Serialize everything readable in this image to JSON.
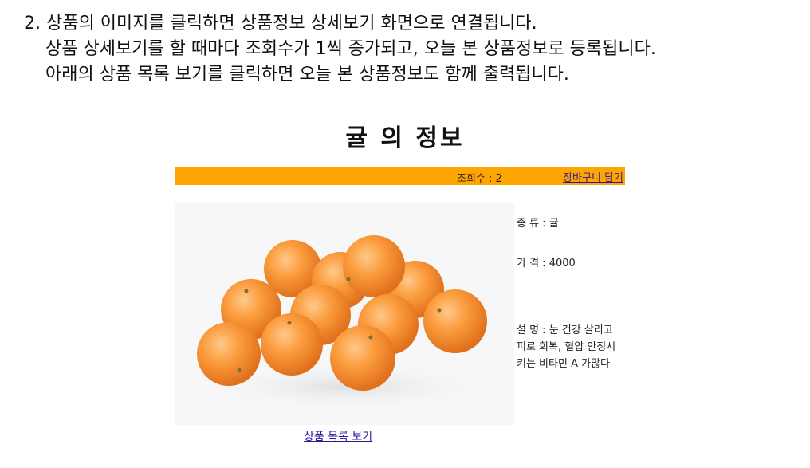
{
  "instructions": [
    "2. 상품의 이미지를 클릭하면 상품정보 상세보기 화면으로 연결됩니다.",
    "상품 상세보기를 할 때마다 조회수가 1씩 증가되고, 오늘 본 상품정보로 등록됩니다.",
    "아래의 상품 목록 보기를 클릭하면 오늘 본 상품정보도 함께 출력됩니다."
  ],
  "page": {
    "title": "귤 의 정보"
  },
  "bar": {
    "views_text": "조회수 : 2",
    "cart_link": "장바구니 담기",
    "color": "#ffa500"
  },
  "product": {
    "image_icon": "tangerine-photo",
    "kind_text": "종 류 : 귤",
    "price_text": "가 격 : 4000",
    "desc_text": "설 명 : 눈 건강 살리고 피로 회복, 혈압 안정시키는 비타민 A 가많다"
  },
  "footer": {
    "list_link": "상품 목록 보기"
  }
}
